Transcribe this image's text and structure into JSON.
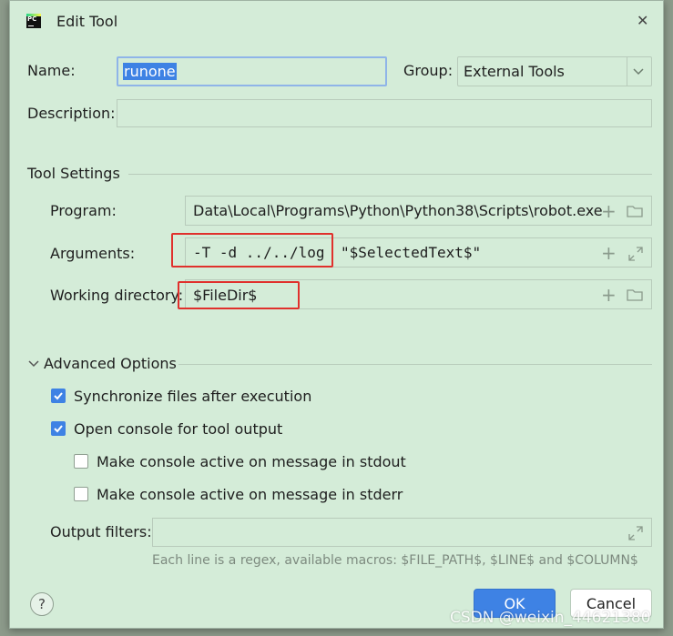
{
  "window": {
    "app_icon_text": "PC",
    "title": "Edit Tool",
    "close_glyph": "✕"
  },
  "form": {
    "name_label": "Name:",
    "name_value": "runone",
    "group_label": "Group:",
    "group_value": "External Tools",
    "description_label": "Description:",
    "description_value": ""
  },
  "tool_settings": {
    "section_title": "Tool Settings",
    "program_label": "Program:",
    "program_value": "Data\\Local\\Programs\\Python\\Python38\\Scripts\\robot.exe",
    "arguments_label": "Arguments:",
    "arguments_value_part1": "-T -d ../../log",
    "arguments_value_part2": "\"$SelectedText$\"",
    "working_dir_label": "Working directory:",
    "working_dir_value": "$FileDir$"
  },
  "advanced": {
    "section_title": "Advanced Options",
    "options": [
      {
        "label": "Synchronize files after execution",
        "checked": true
      },
      {
        "label": "Open console for tool output",
        "checked": true
      },
      {
        "label": "Make console active on message in stdout",
        "checked": false
      },
      {
        "label": "Make console active on message in stderr",
        "checked": false
      }
    ],
    "output_filters_label": "Output filters:",
    "output_filters_value": "",
    "hint": "Each line is a regex, available macros: $FILE_PATH$, $LINE$ and $COLUMN$"
  },
  "buttons": {
    "help": "?",
    "ok": "OK",
    "cancel": "Cancel"
  },
  "watermark": "CSDN @weixin_44621380",
  "colors": {
    "dialog_bg": "#d4ecd8",
    "accent": "#3e82e4",
    "highlight_border": "#e0302c"
  },
  "icons": [
    "pycharm-logo",
    "close-icon",
    "chevron-down-icon",
    "plus-icon",
    "folder-icon",
    "expand-icon",
    "check-icon",
    "help-icon"
  ]
}
